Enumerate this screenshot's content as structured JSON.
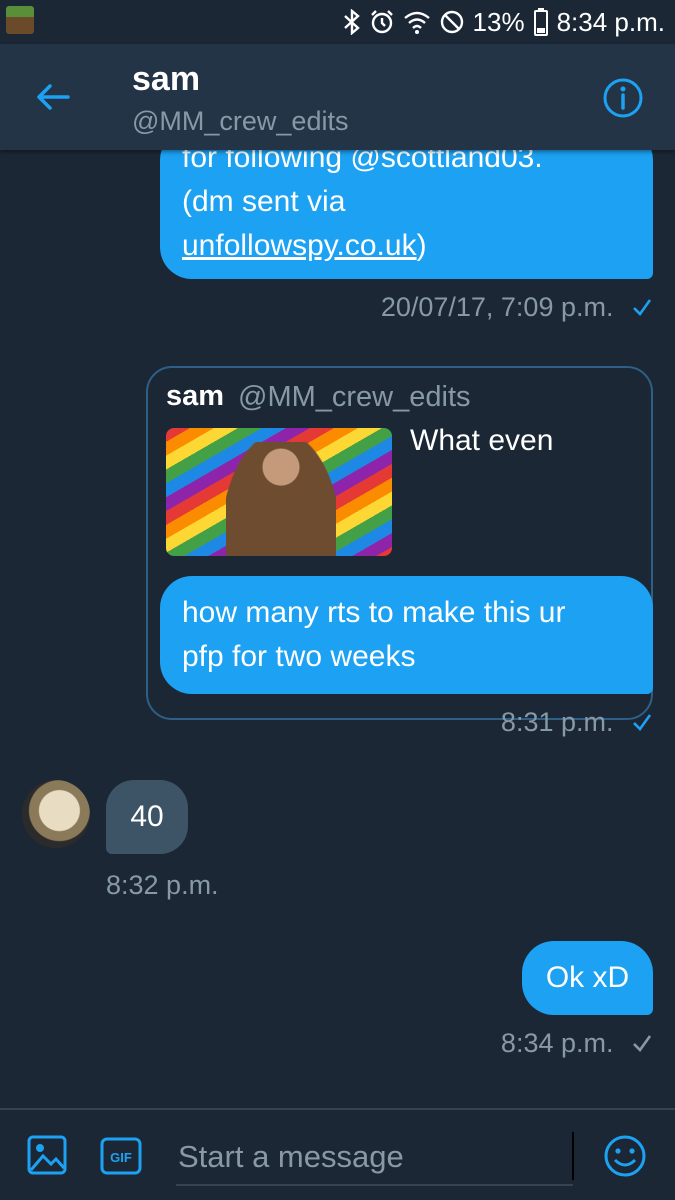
{
  "status_bar": {
    "battery": "13%",
    "time": "8:34 p.m."
  },
  "header": {
    "name": "sam",
    "handle": "@MM_crew_edits"
  },
  "messages": {
    "m1": {
      "line1": "for following @scottland03.",
      "line2": "(dm sent via",
      "link": "unfollowspy.co.uk",
      "closing": ")",
      "timestamp": "20/07/17, 7:09 p.m."
    },
    "quote": {
      "name": "sam",
      "handle": "@MM_crew_edits",
      "text": "What even"
    },
    "m2": {
      "line1": "how many rts to make this ur",
      "line2": "pfp for two weeks",
      "timestamp": "8:31 p.m."
    },
    "m3": {
      "text": "40",
      "timestamp": "8:32 p.m."
    },
    "m4": {
      "text": "Ok xD",
      "timestamp": "8:34 p.m."
    }
  },
  "compose": {
    "placeholder": "Start a message",
    "gif_label": "GIF"
  },
  "colors": {
    "accent": "#1da1f2",
    "background": "#1b2735",
    "header": "#243447",
    "muted": "#8899a6"
  }
}
